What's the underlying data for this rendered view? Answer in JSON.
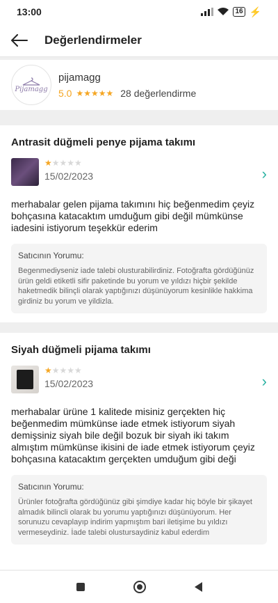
{
  "status": {
    "time": "13:00",
    "battery": "16"
  },
  "header": {
    "title": "Değerlendirmeler"
  },
  "store": {
    "logo_text": "Pijamagg",
    "name": "pijamagg",
    "rating": "5.0",
    "reviews": "28 değerlendirme"
  },
  "reviews": [
    {
      "title": "Antrasit düğmeli penye pijama takımı",
      "rating": 1,
      "date": "15/02/2023",
      "text": "merhabalar gelen pijama takımını hiç beğenmedim çeyiz bohçasına katacaktım umduğum gibi değil mümkünse iadesini istiyorum teşekkür ederim",
      "seller_label": "Satıcının Yorumu:",
      "seller_text": "Begenmediyseniz iade talebi olusturabilirdiniz. Fotoğrafta gördüğünüz ürün geldi etiketli sifir paketinde bu yorum ve yıldızı hiçbir şekilde haketmedik bilinçli olarak yaptığınızı düşünüyorum kesinlikle hakkima girdiniz bu yorum ve yildizla."
    },
    {
      "title": "Siyah düğmeli pijama takımı",
      "rating": 1,
      "date": "15/02/2023",
      "text": "merhabalar ürüne 1 kalitede misiniz gerçekten hiç beğenmedim mümkünse iade etmek istiyorum siyah demişsiniz siyah bile değil bozuk bir siyah iki takım almıştım mümkünse ikisini de iade etmek istiyorum çeyiz bohçasına katacaktım gerçekten umduğum gibi deği",
      "seller_label": "Satıcının Yorumu:",
      "seller_text": "Ürünler fotoğrafta gördüğünüz gibi şimdiye kadar hiç böyle bir şikayet almadık bilincli olarak bu yorumu yaptığınızı düşünüyorum. Her sorunuzu cevaplayıp indirim yapmıştım bari iletişime bu yıldızı vermeseydiniz. İade talebi olustursaydiniz kabul ederdim"
    }
  ],
  "colors": {
    "accent": "#2bb3a3",
    "star": "#f5a623"
  },
  "icons": {
    "back": "arrow-left-icon",
    "chevron": "chevron-right-icon"
  }
}
